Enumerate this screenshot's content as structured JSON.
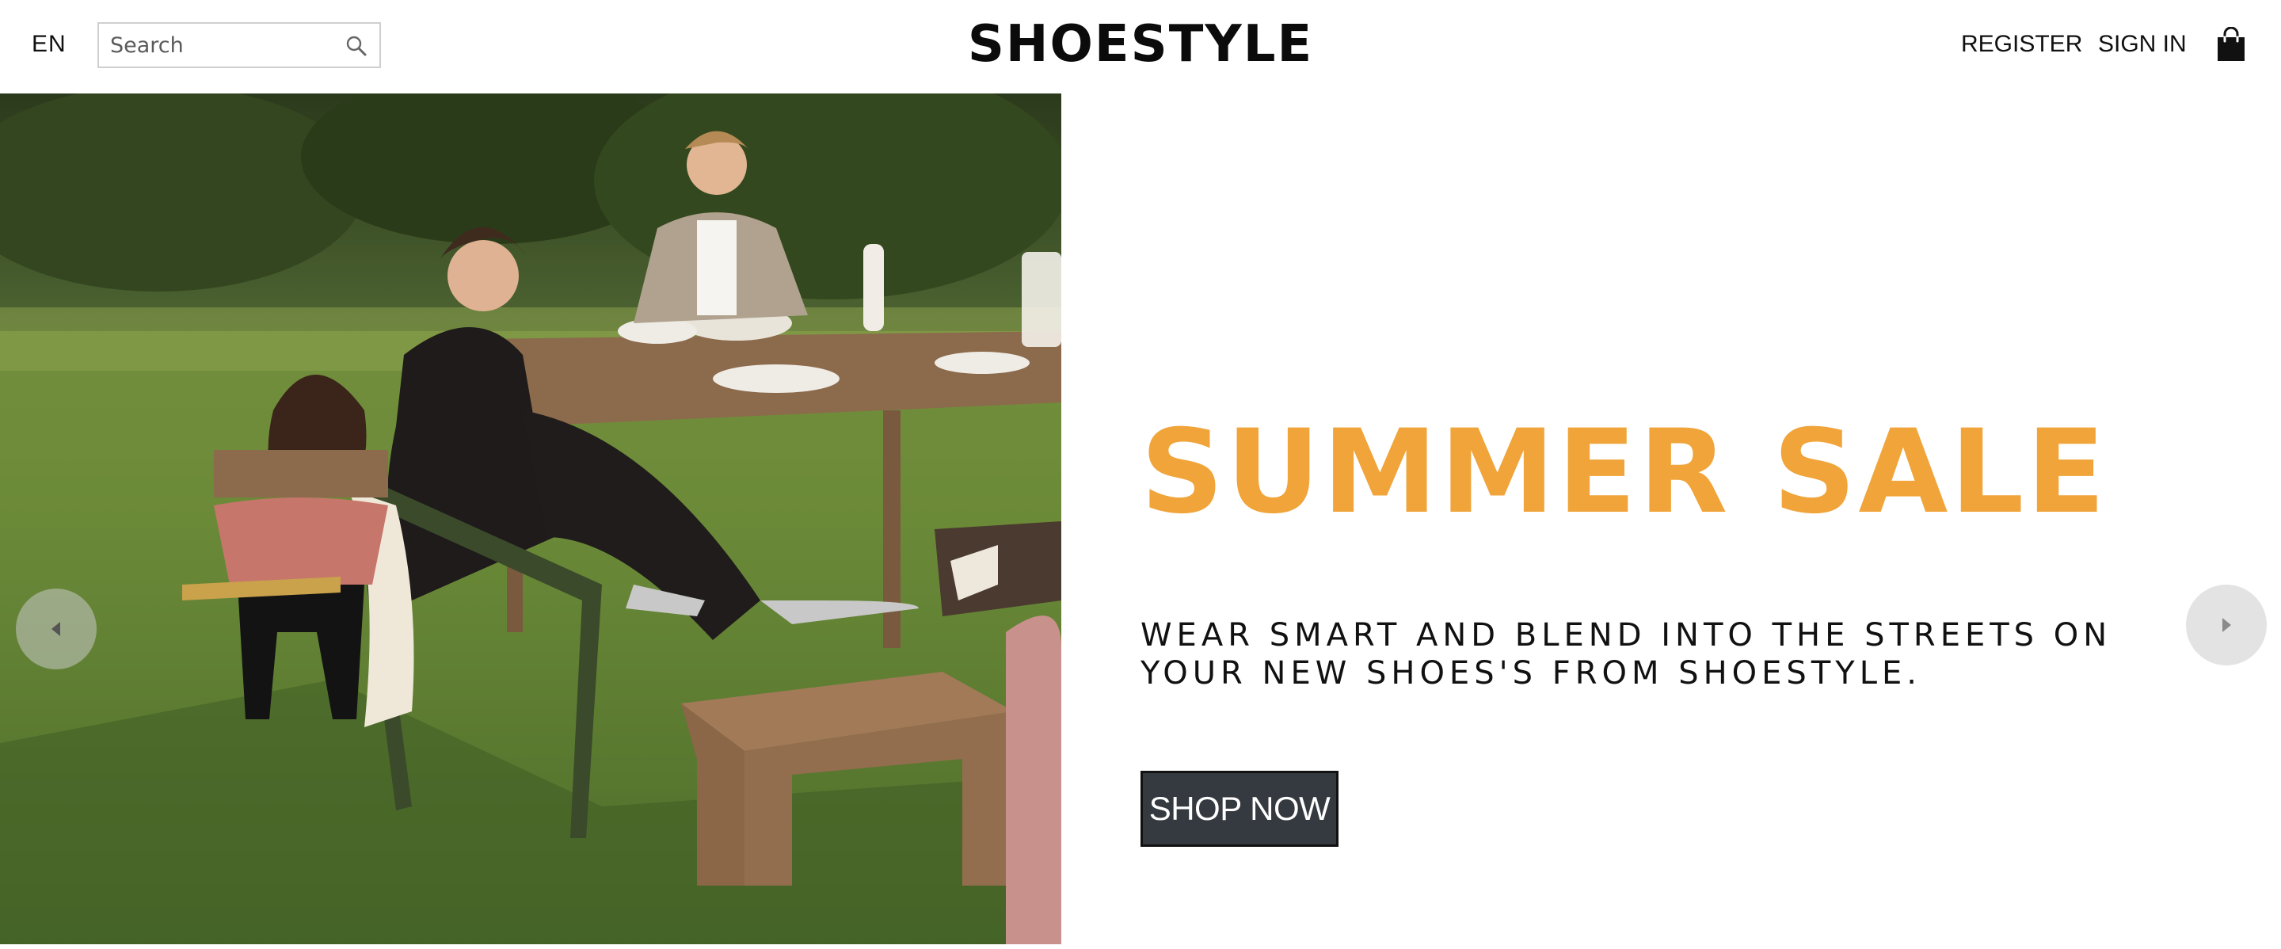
{
  "header": {
    "language": "EN",
    "search_placeholder": "Search",
    "brand": "SHOESTYLE",
    "register_label": "REGISTER",
    "signin_label": "SIGN IN"
  },
  "hero": {
    "title": "SUMMER SALE",
    "subtitle": "WEAR SMART AND BLEND INTO THE STREETS ON YOUR NEW SHOES'S FROM SHOESTYLE.",
    "cta_label": "SHOP NOW"
  },
  "icons": {
    "search": "search-icon",
    "cart": "shopping-bag-icon",
    "prev": "chevron-left-icon",
    "next": "chevron-right-icon"
  },
  "colors": {
    "accent": "#f0a43a",
    "button_bg": "#353a40",
    "text": "#111111"
  }
}
